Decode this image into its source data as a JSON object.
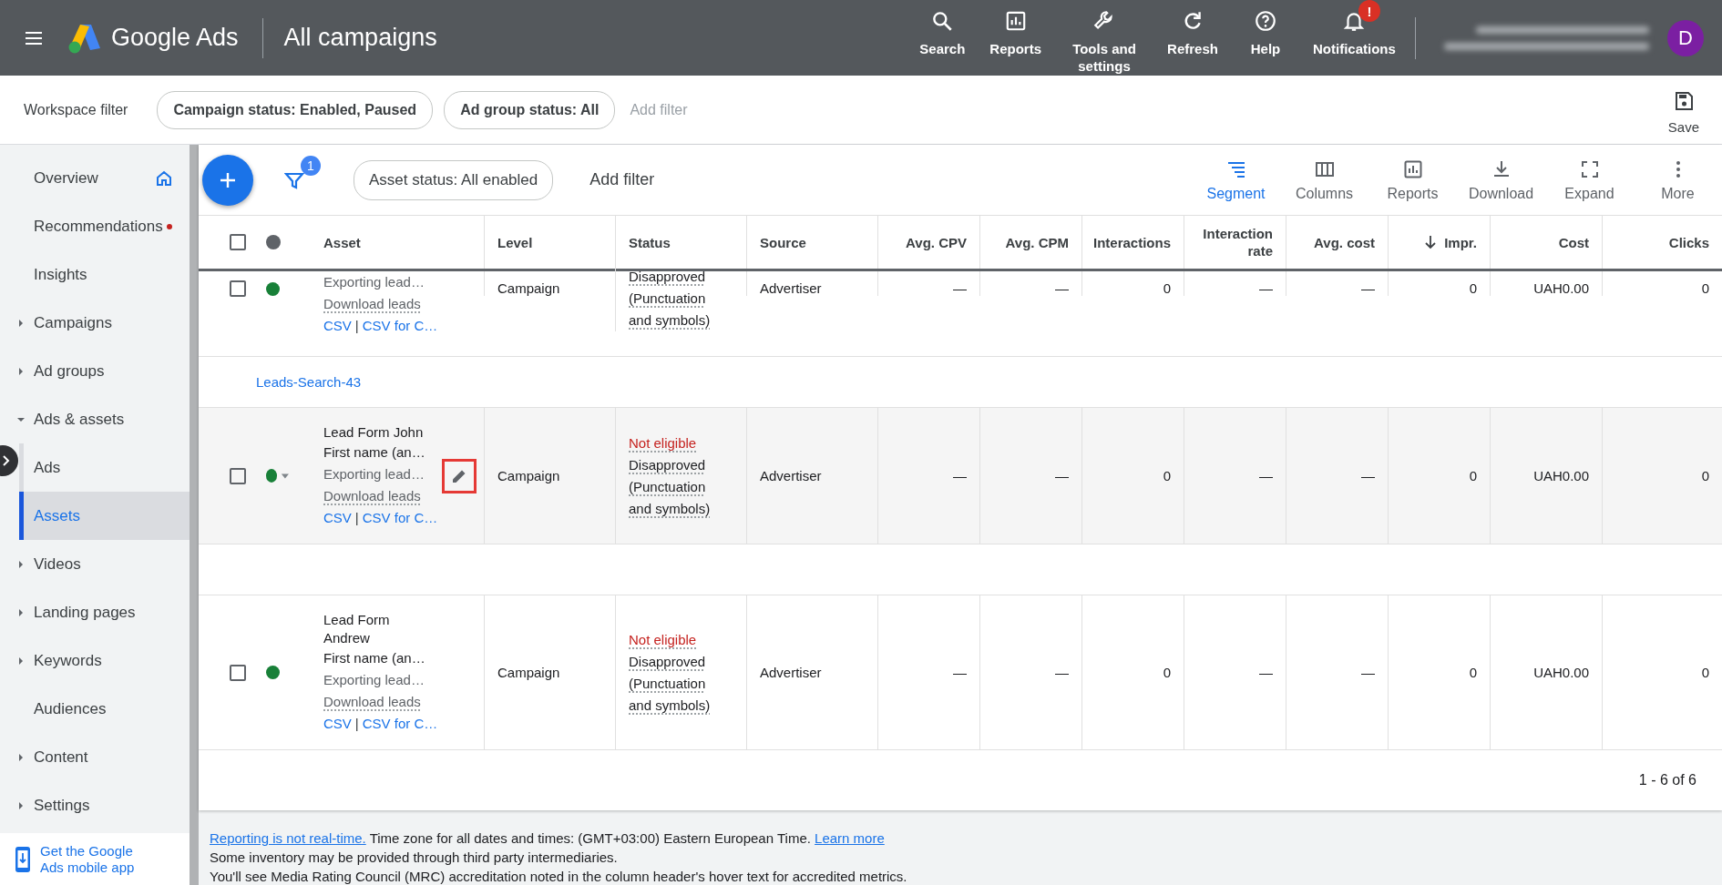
{
  "top_bar": {
    "product": "Google Ads",
    "page_title": "All campaigns",
    "avatar": "D",
    "nav": [
      {
        "label": "Search"
      },
      {
        "label": "Reports"
      },
      {
        "label": "Tools and settings"
      },
      {
        "label": "Refresh"
      },
      {
        "label": "Help"
      },
      {
        "label": "Notifications",
        "badge": "!"
      }
    ]
  },
  "workspace_filter": {
    "label": "Workspace filter",
    "chips": [
      "Campaign status: Enabled, Paused",
      "Ad group status: All"
    ],
    "add_filter": "Add filter",
    "save": "Save"
  },
  "sidebar": {
    "items": [
      {
        "label": "Overview",
        "kind": "home",
        "expandable": false,
        "expanded": false,
        "selected": false,
        "dot": false
      },
      {
        "label": "Recommendations",
        "kind": "link",
        "expandable": false,
        "expanded": false,
        "selected": false,
        "dot": true
      },
      {
        "label": "Insights",
        "kind": "link",
        "expandable": false,
        "expanded": false,
        "selected": false,
        "dot": false
      },
      {
        "label": "Campaigns",
        "kind": "link",
        "expandable": true,
        "expanded": false,
        "selected": false,
        "dot": false
      },
      {
        "label": "Ad groups",
        "kind": "link",
        "expandable": true,
        "expanded": false,
        "selected": false,
        "dot": false
      },
      {
        "label": "Ads & assets",
        "kind": "link",
        "expandable": true,
        "expanded": true,
        "selected": false,
        "dot": false,
        "children": [
          {
            "label": "Ads",
            "selected": false
          },
          {
            "label": "Assets",
            "selected": true
          }
        ]
      },
      {
        "label": "Videos",
        "kind": "link",
        "expandable": true,
        "expanded": false,
        "selected": false,
        "dot": false
      },
      {
        "label": "Landing pages",
        "kind": "link",
        "expandable": true,
        "expanded": false,
        "selected": false,
        "dot": false
      },
      {
        "label": "Keywords",
        "kind": "link",
        "expandable": true,
        "expanded": false,
        "selected": false,
        "dot": false
      },
      {
        "label": "Audiences",
        "kind": "link",
        "expandable": false,
        "expanded": false,
        "selected": false,
        "dot": false
      },
      {
        "label": "Content",
        "kind": "link",
        "expandable": true,
        "expanded": false,
        "selected": false,
        "dot": false
      },
      {
        "label": "Settings",
        "kind": "link",
        "expandable": true,
        "expanded": false,
        "selected": false,
        "dot": false
      }
    ],
    "mobile_app": "Get the Google Ads mobile app"
  },
  "toolbar": {
    "filter_count": "1",
    "chips": [
      "Asset status: All enabled"
    ],
    "add_filter": "Add filter",
    "actions": [
      {
        "label": "Segment",
        "selected": true
      },
      {
        "label": "Columns",
        "selected": false
      },
      {
        "label": "Reports",
        "selected": false
      },
      {
        "label": "Download",
        "selected": false
      },
      {
        "label": "Expand",
        "selected": false
      },
      {
        "label": "More",
        "selected": false
      }
    ]
  },
  "table": {
    "select_all_checked": false,
    "columns": [
      {
        "label": "Asset",
        "sorted": false
      },
      {
        "label": "Level",
        "sorted": false
      },
      {
        "label": "Status",
        "sorted": false
      },
      {
        "label": "Source",
        "sorted": false
      },
      {
        "label": "Avg. CPV",
        "sorted": false
      },
      {
        "label": "Avg. CPM",
        "sorted": false
      },
      {
        "label": "Interactions",
        "sorted": false
      },
      {
        "label": "Interaction rate",
        "sorted": false
      },
      {
        "label": "Avg. cost",
        "sorted": false
      },
      {
        "label": "Impr.",
        "sorted": true
      },
      {
        "label": "Cost",
        "sorted": false
      },
      {
        "label": "Clicks",
        "sorted": false
      }
    ],
    "rows": [
      {
        "kind": "asset",
        "clipped": true,
        "checked": false,
        "hovered": false,
        "title_lines": [],
        "exporting": "Exporting lead…",
        "download": "Download leads",
        "links": [
          "CSV",
          "CSV for C…"
        ],
        "link_separator": "|",
        "level": "Campaign",
        "status": "Disapproved (Punctuation and symbols)",
        "source": "Advertiser",
        "metrics": [
          "—",
          "—",
          "0",
          "—",
          "—",
          "0",
          "UAH0.00",
          "0"
        ]
      },
      {
        "kind": "group",
        "label": "Leads-Search-43"
      },
      {
        "kind": "asset",
        "clipped": false,
        "checked": false,
        "hovered": true,
        "edit_highlighted": true,
        "title_lines": [
          "Lead Form John"
        ],
        "detail": "First name (an…",
        "exporting": "Exporting lead…",
        "download": "Download leads",
        "links": [
          "CSV",
          "CSV for C…"
        ],
        "link_separator": "|",
        "level": "Campaign",
        "status_flag": "Not eligible",
        "status": "Disapproved (Punctuation and symbols)",
        "source": "Advertiser",
        "metrics": [
          "—",
          "—",
          "0",
          "—",
          "—",
          "0",
          "UAH0.00",
          "0"
        ]
      },
      {
        "kind": "spacer"
      },
      {
        "kind": "asset",
        "clipped": false,
        "checked": false,
        "hovered": false,
        "title_lines": [
          "Lead Form",
          "Andrew"
        ],
        "detail": "First name (an…",
        "exporting": "Exporting lead…",
        "download": "Download leads",
        "links": [
          "CSV",
          "CSV for C…"
        ],
        "link_separator": "|",
        "level": "Campaign",
        "status_flag": "Not eligible",
        "status": "Disapproved (Punctuation and symbols)",
        "source": "Advertiser",
        "metrics": [
          "—",
          "—",
          "0",
          "—",
          "—",
          "0",
          "UAH0.00",
          "0"
        ]
      }
    ],
    "pagination": "1 - 6 of 6"
  },
  "footer": [
    {
      "lead_link": "Reporting is not real-time.",
      "text": "Time zone for all dates and times: (GMT+03:00) Eastern European Time.",
      "trailing_link": "Learn more"
    },
    {
      "text": "Some inventory may be provided through third party intermediaries."
    },
    {
      "text": "You'll see Media Rating Council (MRC) accreditation noted in the column header's hover text for accredited metrics."
    }
  ]
}
